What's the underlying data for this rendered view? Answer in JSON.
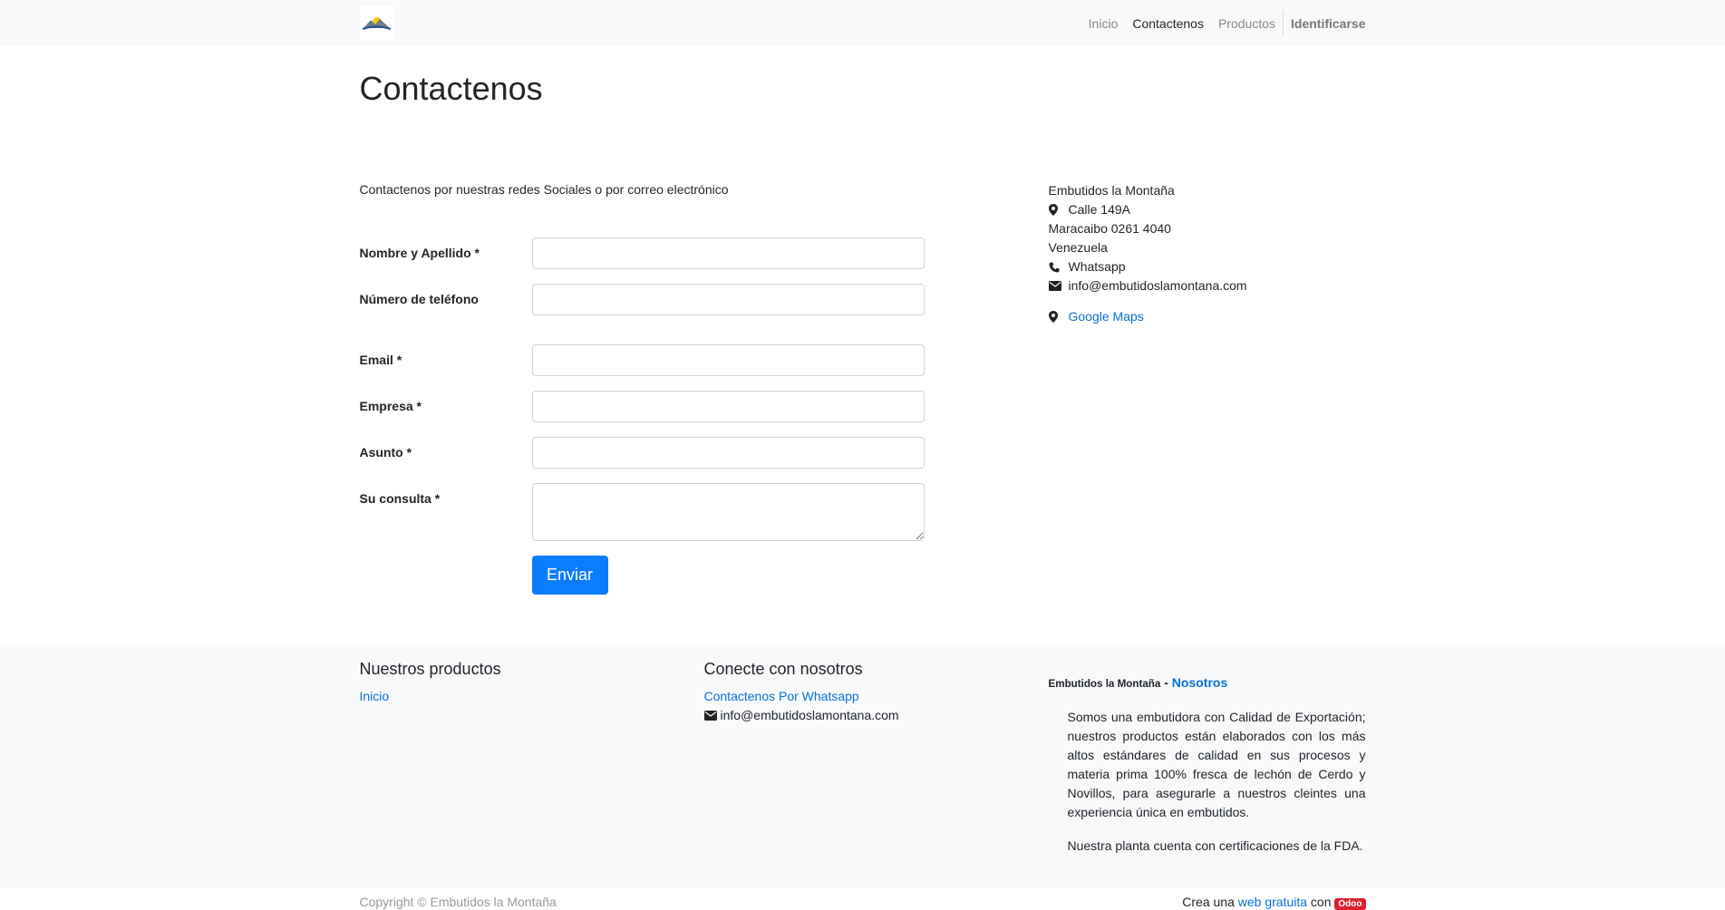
{
  "nav": {
    "items": [
      "Inicio",
      "Contactenos",
      "Productos"
    ],
    "login": "Identificarse"
  },
  "page": {
    "title": "Contactenos",
    "intro": "Contactenos por nuestras redes Sociales o por correo electrónico"
  },
  "form": {
    "fields": [
      {
        "label": "Nombre y Apellido *",
        "value": ""
      },
      {
        "label": "Número de teléfono",
        "value": ""
      },
      {
        "label": "Email *",
        "value": ""
      },
      {
        "label": "Empresa *",
        "value": ""
      },
      {
        "label": "Asunto *",
        "value": ""
      },
      {
        "label": "Su consulta *",
        "value": ""
      }
    ],
    "submit": "Enviar"
  },
  "company": {
    "name": "Embutidos la Montaña",
    "street": "Calle 149A",
    "city": "Maracaibo 0261 4040",
    "country": "Venezuela",
    "phone": "Whatsapp",
    "email": "info@embutidoslamontana.com",
    "maps": "Google Maps"
  },
  "footer": {
    "col1_title": "Nuestros productos",
    "col1_link": "Inicio",
    "col2_title": "Conecte con nosotros",
    "col2_link": "Contactenos Por Whatsapp",
    "col2_email": "info@embutidoslamontana.com",
    "col3_title": "Embutidos la Montaña",
    "col3_dash": " - ",
    "col3_link": "Nosotros",
    "about": "Somos una embutidora con Calidad de Exportación; nuestros productos están elaborados con los más altos estándares de calidad en sus procesos y materia prima 100% fresca de lechón de Cerdo y Novillos, para asegurarle a nuestros cleintes una experiencia única en embutidos.",
    "about2": "Nuestra planta cuenta con certificaciones de la FDA.",
    "copyright": "Copyright © Embutidos la Montaña",
    "crea": "Crea una",
    "web_link": "web gratuita",
    "con": "con",
    "odoo": "Odoo"
  },
  "colors": {
    "accent": "#0a7cff",
    "footer_bg": "#f8f9fa",
    "badge": "#d9232e"
  }
}
